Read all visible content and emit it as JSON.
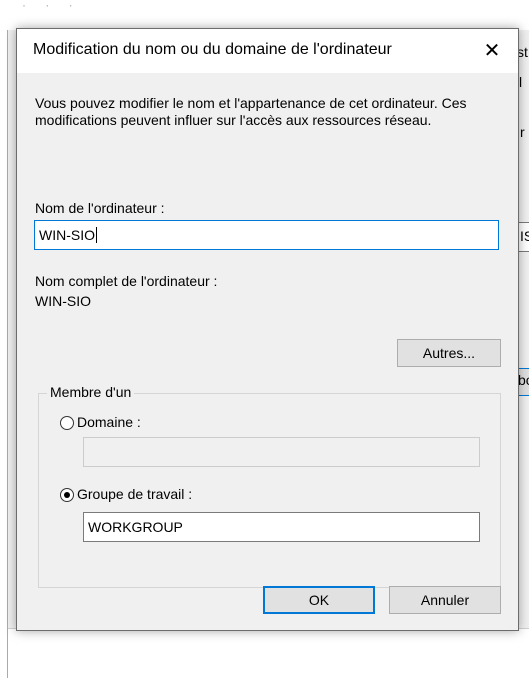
{
  "background": {
    "top_text": "·  ·  ·",
    "frag_right_1": "st",
    "frag_right_2": "l",
    "frag_right_3": "r",
    "frag_right_4": "IS",
    "frag_right_5": "bo"
  },
  "dialog": {
    "title": "Modification du nom ou du domaine de l'ordinateur",
    "close_glyph": "✕",
    "description": "Vous pouvez modifier le nom et l'appartenance de cet ordinateur. Ces modifications peuvent influer sur l'accès aux ressources réseau.",
    "computer_name_label": "Nom de l'ordinateur :",
    "computer_name_value": "WIN-SIO",
    "full_name_label": "Nom complet de l'ordinateur :",
    "full_name_value": "WIN-SIO",
    "more_button": "Autres...",
    "member_of_label": "Membre d'un",
    "domain_label": "Domaine :",
    "domain_value": "",
    "workgroup_label": "Groupe de travail :",
    "workgroup_value": "WORKGROUP",
    "selected_membership": "workgroup",
    "ok_button": "OK",
    "cancel_button": "Annuler"
  }
}
